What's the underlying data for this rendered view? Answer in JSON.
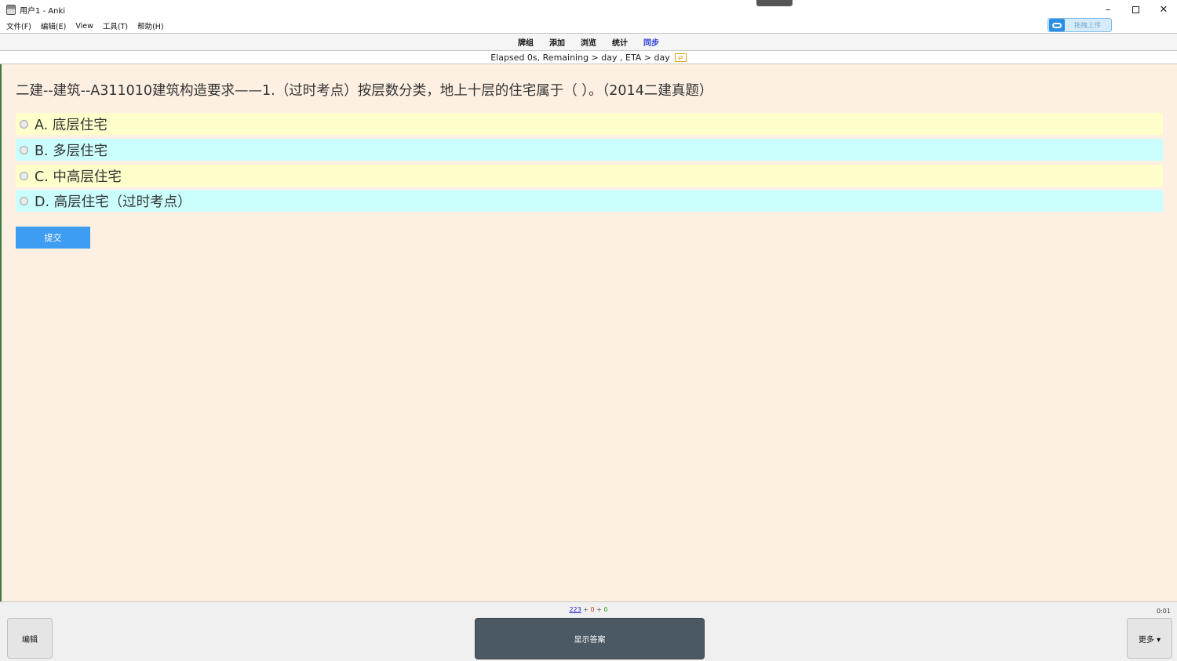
{
  "window": {
    "title": "用户1 - Anki",
    "minimize_glyph": "–",
    "close_glyph": "✕"
  },
  "menubar": {
    "items": [
      "文件(F)",
      "编辑(E)",
      "View",
      "工具(T)",
      "帮助(H)"
    ],
    "upload_label": "拖拽上传"
  },
  "toolbar": {
    "items": [
      "牌组",
      "添加",
      "浏览",
      "统计",
      "同步"
    ]
  },
  "progress": {
    "text": "Elapsed 0s, Remaining > day , ETA > day",
    "icon_glyph": "⇄"
  },
  "card": {
    "question": "二建--建筑--A311010建筑构造要求——1.（过时考点）按层数分类，地上十层的住宅属于（ ）。（2014二建真题）",
    "options": [
      "A. 底层住宅",
      "B. 多层住宅",
      "C. 中高层住宅",
      "D. 高层住宅（过时考点）"
    ],
    "submit_label": "提交",
    "colors": {
      "background": "#fdf0e2",
      "option_yellow": "#ffffcc",
      "option_cyan": "#cbfffe",
      "submit": "#3d9df0"
    }
  },
  "bottom": {
    "new_count": "223",
    "learn_count": "0",
    "review_count": "0",
    "separator": "+",
    "timer": "0:01",
    "edit_label": "编辑",
    "show_answer_label": "显示答案",
    "more_label": "更多 ▾"
  }
}
